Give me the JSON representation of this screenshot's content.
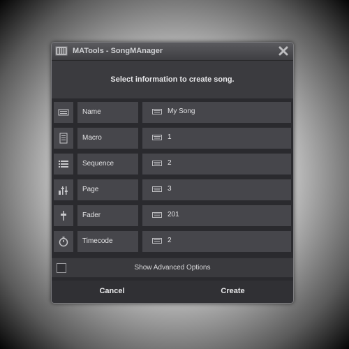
{
  "window": {
    "title": "MATools - SongMAnager",
    "close_icon": "close-icon",
    "app_icon": "ma-console-icon"
  },
  "header": {
    "text": "Select information to create song."
  },
  "fields": [
    {
      "icon": "name-tag-icon",
      "label": "Name",
      "value": "My Song"
    },
    {
      "icon": "macro-icon",
      "label": "Macro",
      "value": "1"
    },
    {
      "icon": "sequence-list-icon",
      "label": "Sequence",
      "value": "2"
    },
    {
      "icon": "page-faders-icon",
      "label": "Page",
      "value": "3"
    },
    {
      "icon": "fader-icon",
      "label": "Fader",
      "value": "201"
    },
    {
      "icon": "stopwatch-icon",
      "label": "Timecode",
      "value": "2"
    }
  ],
  "advanced": {
    "label": "Show Advanced Options",
    "checked": false
  },
  "buttons": {
    "cancel": "Cancel",
    "create": "Create"
  },
  "colors": {
    "dialog_bg": "#2a2a2e",
    "cell_bg": "#46464b",
    "text": "#e4e4e6"
  }
}
